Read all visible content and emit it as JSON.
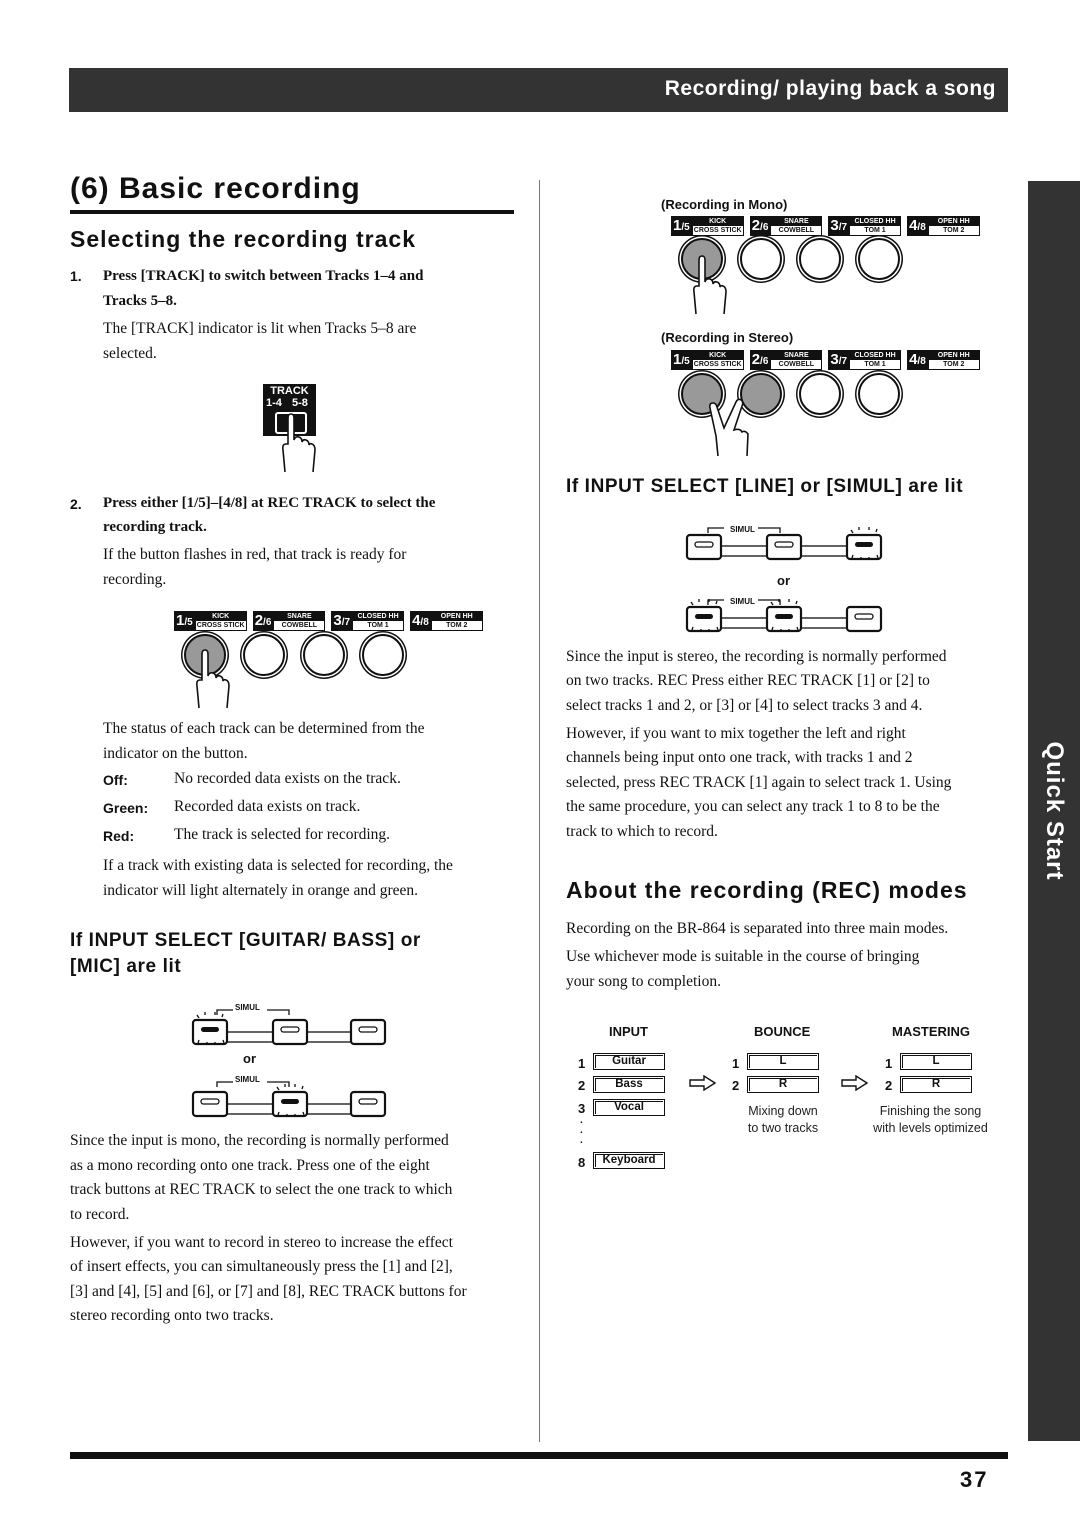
{
  "header": {
    "section_title": "Recording/ playing back a song"
  },
  "side_tab": {
    "label": "Quick Start"
  },
  "page_number": "37",
  "left": {
    "title": "(6) Basic recording",
    "subtitle": "Selecting the recording track",
    "step1": {
      "num": "1.",
      "line1": "Press [TRACK] to switch between Tracks 1–4 and",
      "line2": "Tracks 5–8.",
      "desc1": "The [TRACK] indicator is lit when Tracks 5–8 are",
      "desc2": "selected."
    },
    "track_button": {
      "label": "TRACK",
      "left": "1-4",
      "right": "5-8"
    },
    "step2": {
      "num": "2.",
      "line1": "Press either [1/5]–[4/8] at REC TRACK to select the",
      "line2": "recording track.",
      "desc1": "If the button flashes in red, that track is ready for",
      "desc2": "recording."
    },
    "status_intro1": "The status of each track can be determined from the",
    "status_intro2": "indicator on the button.",
    "status": [
      {
        "key": "Off:",
        "value": "No recorded data exists on the track."
      },
      {
        "key": "Green:",
        "value": "Recorded data exists on track."
      },
      {
        "key": "Red:",
        "value": "The track is selected for recording."
      }
    ],
    "status_note1": "If a track with existing data is selected for recording, the",
    "status_note2": "indicator will light alternately in orange and green.",
    "mono_heading1": "If INPUT SELECT [GUITAR/ BASS] or",
    "mono_heading2": "[MIC] are lit",
    "simul_label": "SIMUL",
    "or_label": "or",
    "mono_para1": [
      "Since the input is mono, the recording is normally performed",
      "as a mono recording onto one track. Press one of the eight",
      "track buttons at REC TRACK to select the one track to which",
      "to record."
    ],
    "mono_para2": [
      "However, if you want to record in stereo to increase the effect",
      "of insert effects, you can simultaneously press the [1] and [2],",
      "[3] and [4], [5] and [6], or [7] and [8], REC TRACK buttons for",
      "stereo recording onto two tracks."
    ]
  },
  "tracks": [
    {
      "num": "1",
      "sub": "5",
      "top": "KICK",
      "bottom": "CROSS STICK"
    },
    {
      "num": "2",
      "sub": "6",
      "top": "SNARE",
      "bottom": "COWBELL"
    },
    {
      "num": "3",
      "sub": "7",
      "top": "CLOSED HH",
      "bottom": "TOM 1"
    },
    {
      "num": "4",
      "sub": "8",
      "top": "OPEN HH",
      "bottom": "TOM 2"
    }
  ],
  "right": {
    "mono_caption": "(Recording in Mono)",
    "stereo_caption": "(Recording in Stereo)",
    "line_heading": "If INPUT SELECT [LINE] or [SIMUL] are lit",
    "stereo_para1": [
      "Since the input is stereo, the recording is normally performed",
      "on two tracks. REC Press either REC TRACK [1] or [2] to",
      "select tracks 1 and 2, or [3] or [4] to select tracks 3 and 4."
    ],
    "stereo_para2": [
      "However, if you want to mix together the left and right",
      "channels being input onto one track, with tracks 1 and 2",
      "selected, press REC TRACK [1] again to select track 1. Using",
      "the same procedure, you can select any track 1 to 8 to be the",
      "track to which to record."
    ],
    "modes_heading": "About the recording (REC) modes",
    "modes_para1": "Recording on the BR-864 is separated into three main modes.",
    "modes_para2": [
      "Use whichever mode is suitable in the course of bringing",
      "your song to completion."
    ],
    "flow": {
      "input": {
        "title": "INPUT",
        "rows": [
          {
            "idx": "1",
            "label": "Guitar"
          },
          {
            "idx": "2",
            "label": "Bass"
          },
          {
            "idx": "3",
            "label": "Vocal"
          },
          {
            "idx": "8",
            "label": "Keyboard"
          }
        ]
      },
      "bounce": {
        "title": "BOUNCE",
        "rows": [
          {
            "idx": "1",
            "label": "L"
          },
          {
            "idx": "2",
            "label": "R"
          }
        ],
        "caption1": "Mixing down",
        "caption2": "to two tracks"
      },
      "mastering": {
        "title": "MASTERING",
        "rows": [
          {
            "idx": "1",
            "label": "L"
          },
          {
            "idx": "2",
            "label": "R"
          }
        ],
        "caption1": "Finishing the song",
        "caption2": "with levels optimized"
      }
    }
  }
}
